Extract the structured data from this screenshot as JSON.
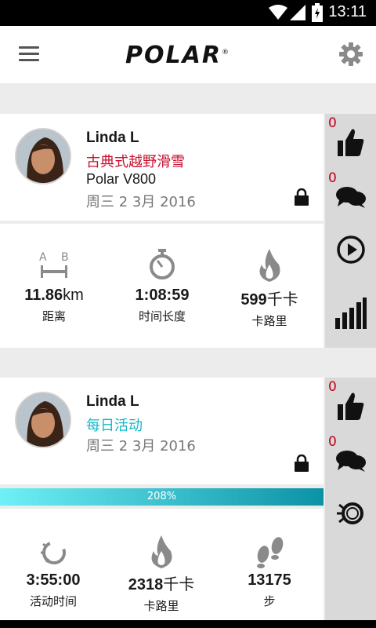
{
  "status_bar": {
    "time": "13:11",
    "icons": [
      "wifi-icon",
      "signal-icon",
      "battery-icon"
    ]
  },
  "app_bar": {
    "logo": "POLAR",
    "logo_mark": "®",
    "icons": [
      "menu-icon",
      "settings-icon"
    ]
  },
  "colors": {
    "sport_red": "#c8102e",
    "daily_cyan": "#14b8c8",
    "count_red": "#c00018"
  },
  "feed": [
    {
      "type": "training",
      "user_name": "Linda L",
      "sport": "古典式越野滑雪",
      "device": "Polar V800",
      "date": "周三 2 3月 2016",
      "likes": "0",
      "comments": "0",
      "stats": [
        {
          "icon": "distance-icon",
          "value": "11.86",
          "unit": "km",
          "label": "距离"
        },
        {
          "icon": "stopwatch-icon",
          "value": "1:08:59",
          "unit": "",
          "label": "时间长度"
        },
        {
          "icon": "flame-icon",
          "value": "599",
          "unit": "千卡",
          "label": "卡路里"
        }
      ],
      "side_icons": [
        "thumbs-up-icon",
        "comments-icon",
        "play-icon",
        "bar-chart-icon"
      ]
    },
    {
      "type": "daily",
      "user_name": "Linda L",
      "sport": "每日活动",
      "date": "周三 2 3月 2016",
      "likes": "0",
      "comments": "0",
      "progress_percent": 208,
      "progress_label": "208%",
      "stats": [
        {
          "icon": "activity-ring-icon",
          "value": "3:55:00",
          "unit": "",
          "label": "活动时间"
        },
        {
          "icon": "flame-icon",
          "value": "2318",
          "unit": "千卡",
          "label": "卡路里"
        },
        {
          "icon": "footsteps-icon",
          "value": "13175",
          "unit": "",
          "label": "步"
        }
      ],
      "side_icons": [
        "thumbs-up-icon",
        "comments-icon",
        "activity-ring-icon"
      ]
    }
  ]
}
